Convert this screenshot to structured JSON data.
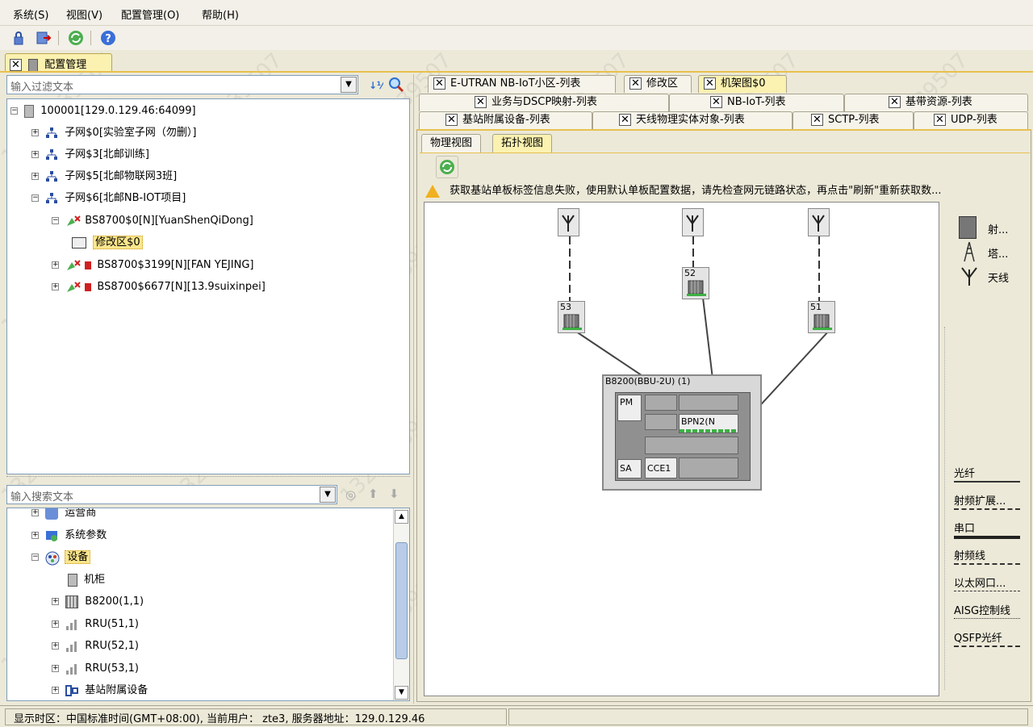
{
  "menu": [
    "系统(S)",
    "视图(V)",
    "配置管理(O)",
    "帮助(H)"
  ],
  "main_tab": {
    "label": "配置管理"
  },
  "left": {
    "filter_placeholder": "输入过滤文本",
    "tree": [
      {
        "label": "100001[129.0.129.46:64099]"
      },
      {
        "label": "子网$0[实验室子网（勿删）]"
      },
      {
        "label": "子网$3[北邮训练]"
      },
      {
        "label": "子网$5[北邮物联网3班]"
      },
      {
        "label": "子网$6[北邮NB-IOT项目]"
      },
      {
        "label": "BS8700$0[N][YuanShenQiDong]"
      },
      {
        "label": "修改区$0"
      },
      {
        "label": "BS8700$3199[N][FAN YEJING]"
      },
      {
        "label": "BS8700$6677[N][13.9suixinpei]"
      }
    ],
    "search_placeholder": "输入搜索文本",
    "tree2": [
      {
        "label": "运营商"
      },
      {
        "label": "系统参数"
      },
      {
        "label": "设备"
      },
      {
        "label": "机柜"
      },
      {
        "label": "B8200(1,1)"
      },
      {
        "label": "RRU(51,1)"
      },
      {
        "label": "RRU(52,1)"
      },
      {
        "label": "RRU(53,1)"
      },
      {
        "label": "基站附属设备"
      }
    ]
  },
  "right": {
    "tabs_row1": [
      "E-UTRAN NB-IoT小区-列表",
      "修改区",
      "机架图$0"
    ],
    "tabs_row2": [
      "业务与DSCP映射-列表",
      "NB-IoT-列表",
      "基带资源-列表"
    ],
    "tabs_row3": [
      "基站附属设备-列表",
      "天线物理实体对象-列表",
      "SCTP-列表",
      "UDP-列表"
    ],
    "subtabs": [
      "物理视图",
      "拓扑视图"
    ],
    "warning": "获取基站单板标签信息失败，使用默认单板配置数据，请先检查网元链路状态，再点击\"刷新\"重新获取数...",
    "topology": {
      "rru": [
        "53",
        "52",
        "51"
      ],
      "bbu_title": "B8200(BBU-2U) (1)",
      "boards": [
        "PM",
        "BPN2(N",
        "SA",
        "CCE1"
      ]
    },
    "legend_top": [
      "射...",
      "塔...",
      "天线"
    ],
    "legend_lines": [
      "光纤",
      "射频扩展...",
      "串口",
      "射频线",
      "以太网口...",
      "AISG控制线",
      "QSFP光纤"
    ]
  },
  "status": "显示时区：中国标准时间(GMT+08:00), 当前用户： zte3, 服务器地址：129.0.129.46",
  "watermark": "13212139507",
  "colors": {
    "accent": "#fbf1b0",
    "selected": "#fbe68c",
    "tree_icon": "#2a4ea0"
  }
}
